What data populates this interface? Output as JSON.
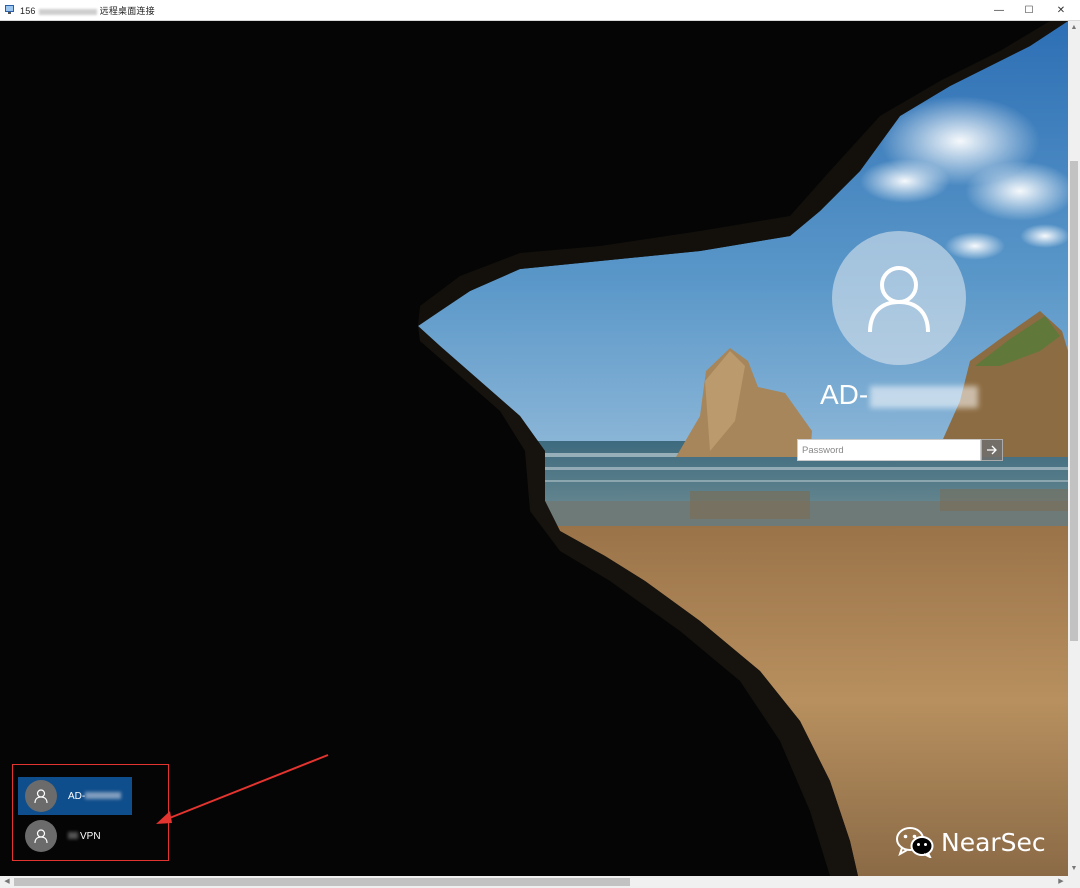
{
  "window": {
    "title_prefix": "156",
    "title_suffix": "远程桌面连接",
    "minimize_label": "—",
    "maximize_label": "☐",
    "close_label": "✕"
  },
  "login": {
    "username": "AD-",
    "password_placeholder": "Password",
    "submit_icon": "arrow-right-icon"
  },
  "user_switcher": {
    "users": [
      {
        "name": "AD-",
        "selected": true
      },
      {
        "name": "VPN",
        "selected": false
      }
    ]
  },
  "watermark": {
    "text": "NearSec",
    "icon": "wechat-icon"
  },
  "colors": {
    "selected_user": "#0f4e8c",
    "annotation": "#e3342f",
    "sky": "#3b78b7",
    "sand": "#b48a5a"
  }
}
